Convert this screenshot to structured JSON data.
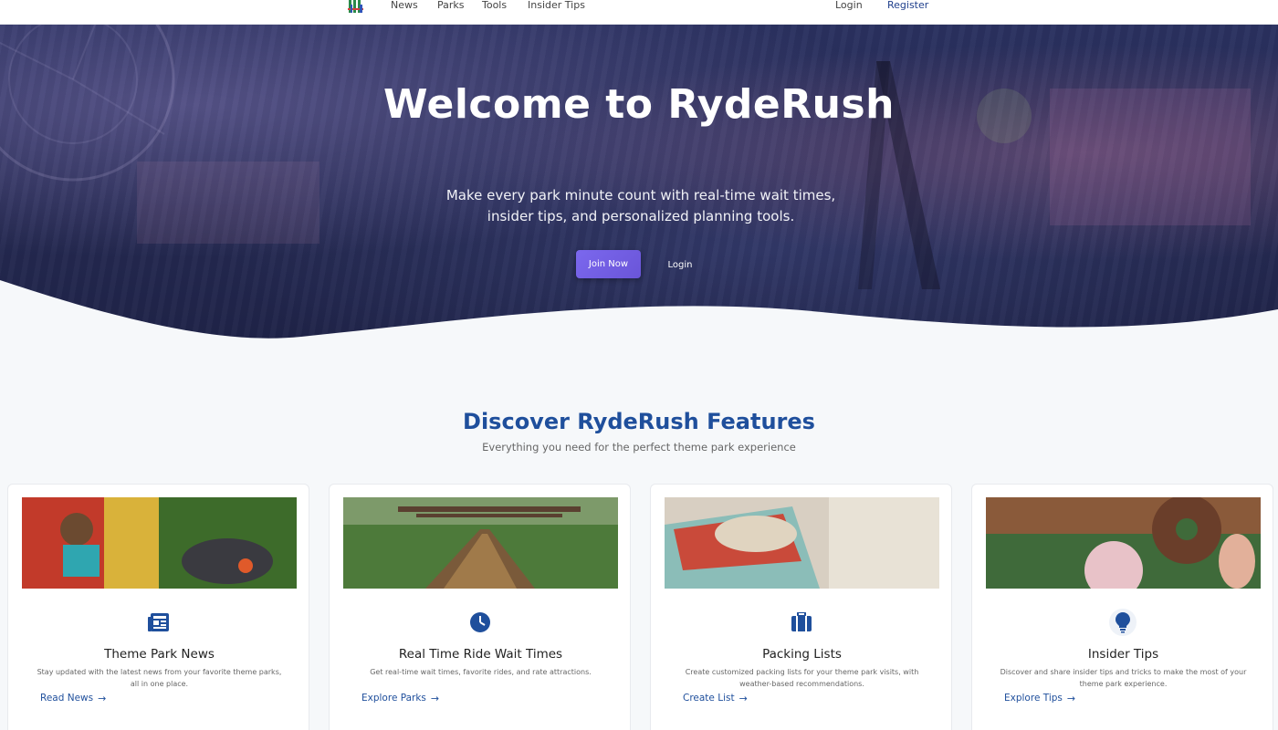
{
  "nav": {
    "logo_name": "ryderush-logo",
    "links": [
      "News",
      "Parks",
      "Tools",
      "Insider Tips"
    ],
    "login": "Login",
    "register": "Register"
  },
  "hero": {
    "title": "Welcome to RydeRush",
    "subtitle": "Make every park minute count with real-time wait times, insider tips, and personalized planning tools.",
    "join_label": "Join Now",
    "login_label": "Login"
  },
  "features": {
    "title": "Discover RydeRush Features",
    "subtitle": "Everything you need for the perfect theme park experience",
    "cards": [
      {
        "icon": "newspaper-icon",
        "title": "Theme Park News",
        "description": "Stay updated with the latest news from your favorite theme parks, all in one place.",
        "link": "Read News"
      },
      {
        "icon": "clock-icon",
        "title": "Real Time Ride Wait Times",
        "description": "Get real-time wait times, favorite rides, and rate attractions.",
        "link": "Explore Parks"
      },
      {
        "icon": "suitcase-icon",
        "title": "Packing Lists",
        "description": "Create customized packing lists for your theme park visits, with weather-based recommendations.",
        "link": "Create List"
      },
      {
        "icon": "lightbulb-icon",
        "title": "Insider Tips",
        "description": "Discover and share insider tips and tricks to make the most of your theme park experience.",
        "link": "Explore Tips"
      }
    ]
  },
  "colors": {
    "accent": "#1f4f9c",
    "button": "#7b68ee",
    "hero_overlay": "#272c55"
  }
}
